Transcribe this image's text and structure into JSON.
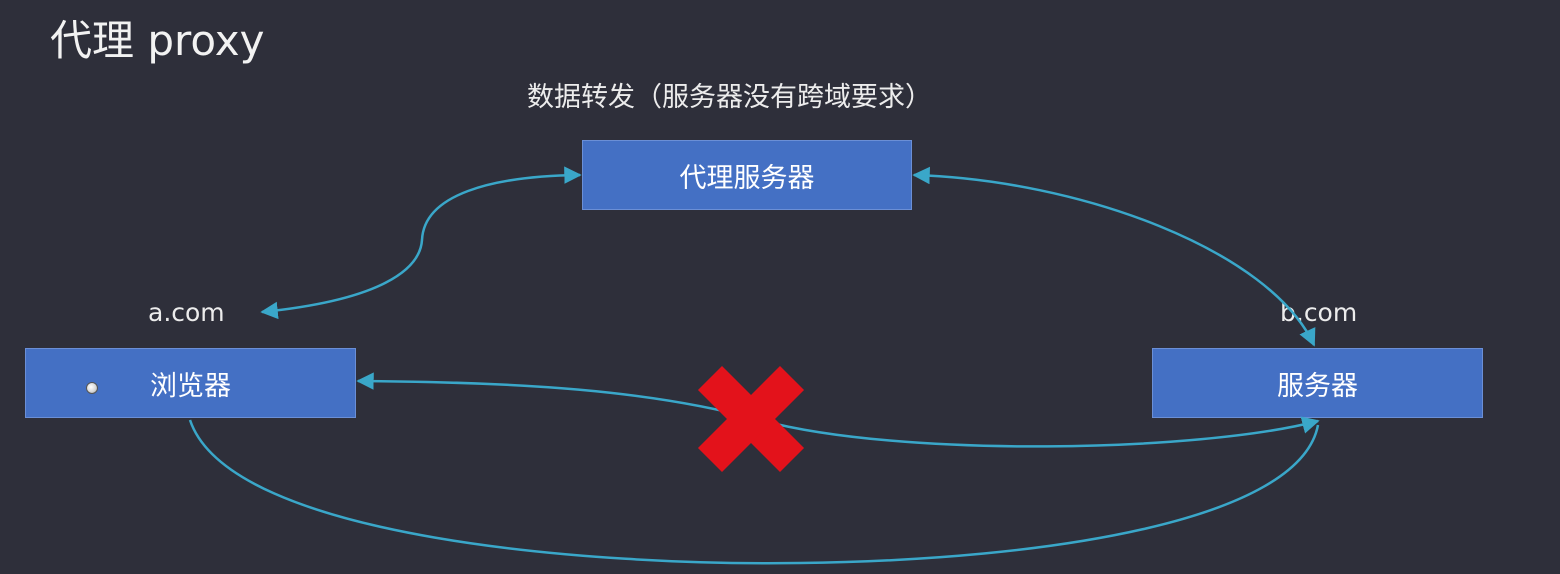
{
  "slide": {
    "title": "代理 proxy",
    "subtitle": "数据转发（服务器没有跨域要求）"
  },
  "nodes": {
    "proxy": {
      "label": "代理服务器"
    },
    "browser": {
      "label": "浏览器",
      "domain": "a.com"
    },
    "server": {
      "label": "服务器",
      "domain": "b.com"
    }
  },
  "colors": {
    "background": "#2e2f3a",
    "box_fill": "#4470c4",
    "arrow": "#3aa7c9",
    "blocked_mark": "#e3121b"
  },
  "icons": {
    "blocked": "red-x-icon",
    "cursor": "mouse-cursor-icon"
  }
}
